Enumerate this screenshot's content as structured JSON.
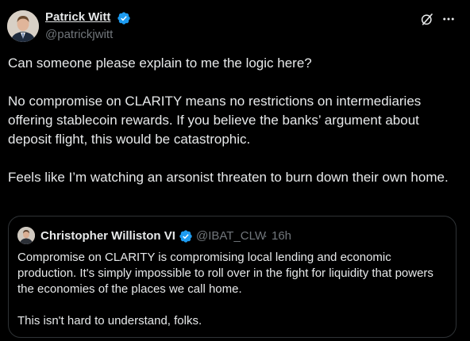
{
  "tweet": {
    "author": {
      "name": "Patrick Witt",
      "handle": "@patrickjwitt",
      "verified_color": "#1d9bf0"
    },
    "paragraphs": [
      "Can someone please explain to me the logic here?",
      "No compromise on CLARITY means no restrictions on intermediaries offering stablecoin rewards. If you believe the banks’ argument about deposit flight, this would be catastrophic.",
      "Feels like I’m watching an arsonist threaten to burn down their own home."
    ],
    "actions": {
      "grok_icon": "grok-icon",
      "more_icon": "more-horizontal-icon"
    }
  },
  "quote": {
    "author": {
      "name": "Christopher Williston VI",
      "handle": "@IBAT_CLW",
      "separator": "·",
      "time": "16h"
    },
    "paragraphs": [
      "Compromise on CLARITY is compromising local lending and economic production.  It's simply impossible to roll over in the fight for liquidity that powers the economies of the places we call home.",
      "This isn't hard to understand, folks."
    ]
  },
  "colors": {
    "background": "#000000",
    "text": "#e7e9ea",
    "secondary": "#71767b",
    "border": "#2f3336",
    "verified": "#1d9bf0"
  }
}
